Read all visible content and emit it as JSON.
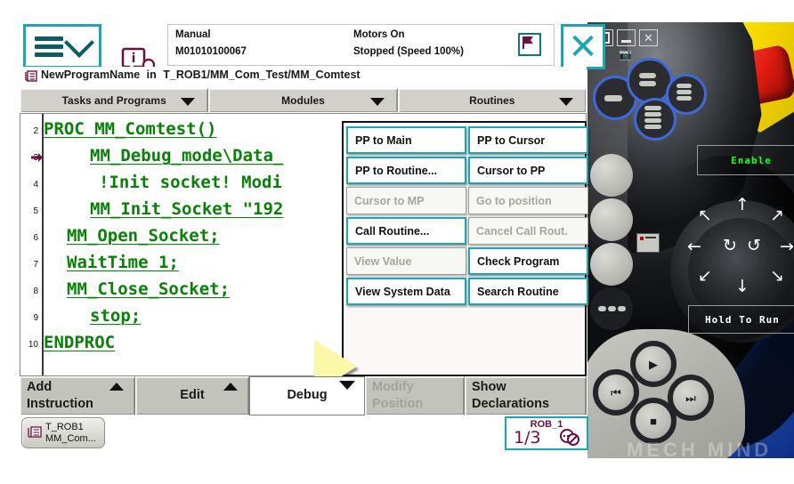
{
  "header": {
    "menu_button": "menu-button",
    "operator_icon": "operator-info-icon",
    "mode": "Manual",
    "system_id": "M01010100067",
    "motors": "Motors On",
    "run_state": "Stopped (Speed 100%)",
    "flag_icon": "stop-flag-icon",
    "close_label": "✕"
  },
  "breadcrumb": {
    "icon": "program-icon",
    "program": "NewProgramName",
    "separator": "in",
    "path": "T_ROB1/MM_Com_Test/MM_Comtest"
  },
  "tabs": [
    {
      "label": "Tasks and Programs"
    },
    {
      "label": "Modules"
    },
    {
      "label": "Routines"
    }
  ],
  "editor": {
    "lines": [
      {
        "no": "2",
        "indent": 0,
        "text": "PROC MM_Comtest()",
        "pp": false
      },
      {
        "no": "3",
        "indent": 52,
        "text": "MM_Debug_mode\\Data_",
        "pp": true
      },
      {
        "no": "4",
        "indent": 62,
        "text": "!Init socket! Modi",
        "pp": false
      },
      {
        "no": "5",
        "indent": 52,
        "text": "MM_Init_Socket \"192",
        "pp": false
      },
      {
        "no": "6",
        "indent": 26,
        "text": "MM_Open_Socket;",
        "pp": false
      },
      {
        "no": "7",
        "indent": 26,
        "text": "WaitTime 1;",
        "pp": false
      },
      {
        "no": "8",
        "indent": 26,
        "text": "MM_Close_Socket;",
        "pp": false
      },
      {
        "no": "9",
        "indent": 52,
        "text": "stop;",
        "pp": false
      },
      {
        "no": "10",
        "indent": 0,
        "text": "ENDPROC",
        "pp": false
      }
    ],
    "cursor_icon": "yellow-pointer-cursor"
  },
  "popup": {
    "buttons": [
      {
        "label": "PP to Main",
        "enabled": true
      },
      {
        "label": "PP to Cursor",
        "enabled": true
      },
      {
        "label": "PP to Routine...",
        "enabled": true
      },
      {
        "label": "Cursor to PP",
        "enabled": true
      },
      {
        "label": "Cursor to MP",
        "enabled": false
      },
      {
        "label": "Go to position",
        "enabled": false
      },
      {
        "label": "Call Routine...",
        "enabled": true
      },
      {
        "label": "Cancel Call Rout.",
        "enabled": false
      },
      {
        "label": "View Value",
        "enabled": false
      },
      {
        "label": "Check Program",
        "enabled": true
      },
      {
        "label": "View System Data",
        "enabled": true
      },
      {
        "label": "Search Routine",
        "enabled": true
      }
    ]
  },
  "actions": [
    {
      "line1": "Add",
      "line2": "Instruction",
      "mode": "two-line",
      "caret": "up",
      "selected": false,
      "dim": false
    },
    {
      "line1": "Edit",
      "line2": "",
      "mode": "center",
      "caret": "up",
      "selected": false,
      "dim": false
    },
    {
      "line1": "Debug",
      "line2": "",
      "mode": "center",
      "caret": "down",
      "selected": true,
      "dim": false
    },
    {
      "line1": "Modify",
      "line2": "Position",
      "mode": "two-line",
      "caret": "none",
      "selected": false,
      "dim": true
    },
    {
      "line1": "Show",
      "line2": "Declarations",
      "mode": "two-line",
      "caret": "none",
      "selected": false,
      "dim": false
    }
  ],
  "taskbar": {
    "task_icon": "task-window-icon",
    "task_line1": "T_ROB1",
    "task_line2": "MM_Com...",
    "robot_name": "ROB_1",
    "robot_fraction": "1/3",
    "robot_badge_icon": "no-axis-icon"
  },
  "pendant": {
    "window_buttons": [
      "restore-icon",
      "minimize-icon",
      "close-icon"
    ],
    "small_icons": [
      "switch-icon",
      "camera-icon"
    ],
    "enable_label": "Enable",
    "hold_to_run_label": "Hold To Run",
    "transport_buttons": [
      "prev-icon",
      "play-icon",
      "next-icon",
      "stop-icon"
    ],
    "watermark": "MECH MIND"
  },
  "colors": {
    "accent_teal": "#1ca6b5",
    "code_green": "#098109",
    "maroon": "#6b1040",
    "toolbar_grey": "#c3c3bd",
    "tab_grey": "#d2d0cb",
    "pendant_blue": "#1546b4",
    "estop_red": "#e01b10",
    "shell_yellow": "#ffe200",
    "cursor_yellow": "#fbf8a8",
    "enable_green": "#1aff1a"
  }
}
